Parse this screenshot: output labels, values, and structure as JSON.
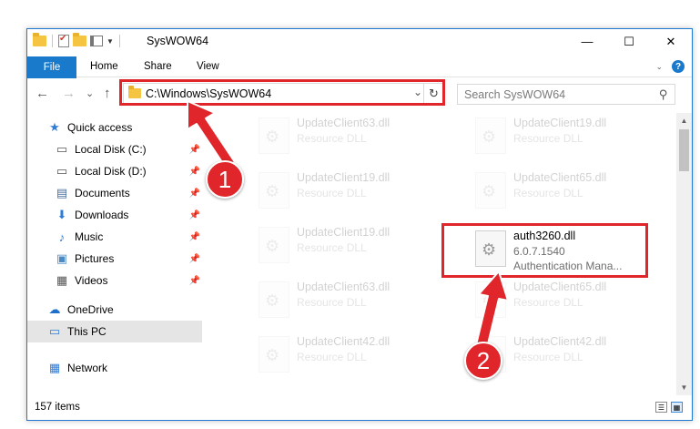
{
  "window": {
    "title": "SysWOW64",
    "minimize": "—",
    "maximize": "☐",
    "close": "✕"
  },
  "ribbon": {
    "tabs": [
      "File",
      "Home",
      "Share",
      "View"
    ]
  },
  "nav": {
    "back": "←",
    "forward": "→",
    "recent": "⌄",
    "up": "↑",
    "address": "C:\\Windows\\SysWOW64",
    "chevron": "⌄",
    "refresh": "↻",
    "search_placeholder": "Search SysWOW64",
    "search_glyph": "⚲"
  },
  "sidebar": {
    "items": [
      {
        "label": "Quick access",
        "icon": "star-icon",
        "glyph": "★",
        "color": "#2f7bd6",
        "pinned": false
      },
      {
        "label": "Local Disk (C:)",
        "icon": "drive-icon",
        "glyph": "▭",
        "color": "#555555",
        "pinned": true
      },
      {
        "label": "Local Disk (D:)",
        "icon": "drive-icon",
        "glyph": "▭",
        "color": "#555555",
        "pinned": true
      },
      {
        "label": "Documents",
        "icon": "document-icon",
        "glyph": "▤",
        "color": "#4d6f9b",
        "pinned": true
      },
      {
        "label": "Downloads",
        "icon": "download-icon",
        "glyph": "⬇",
        "color": "#2f7bd6",
        "pinned": true
      },
      {
        "label": "Music",
        "icon": "music-icon",
        "glyph": "♪",
        "color": "#2f7bd6",
        "pinned": true
      },
      {
        "label": "Pictures",
        "icon": "pictures-icon",
        "glyph": "▣",
        "color": "#4d8ac6",
        "pinned": true
      },
      {
        "label": "Videos",
        "icon": "video-icon",
        "glyph": "▦",
        "color": "#555555",
        "pinned": true
      },
      {
        "label": "OneDrive",
        "icon": "cloud-icon",
        "glyph": "☁",
        "color": "#1e6fc8",
        "pinned": false
      },
      {
        "label": "This PC",
        "icon": "computer-icon",
        "glyph": "▭",
        "color": "#2f7bd6",
        "pinned": false
      },
      {
        "label": "Network",
        "icon": "network-icon",
        "glyph": "▦",
        "color": "#2f7bd6",
        "pinned": false
      }
    ],
    "pin_glyph": "📌"
  },
  "files": [
    {
      "name": "UpdateClient63.dll",
      "type": "Resource DLL",
      "faded": true
    },
    {
      "name": "UpdateClient19.dll",
      "type": "Resource DLL",
      "faded": true
    },
    {
      "name": "UpdateClient19.dll",
      "type": "Resource DLL",
      "faded": true
    },
    {
      "name": "UpdateClient65.dll",
      "type": "Resource DLL",
      "faded": true
    },
    {
      "name": "UpdateClient19.dll",
      "type": "Resource DLL",
      "faded": true
    },
    {
      "name": "auth3260.dll",
      "version": "6.0.7.1540",
      "type": "Authentication Mana...",
      "faded": false
    },
    {
      "name": "UpdateClient63.dll",
      "type": "Resource DLL",
      "faded": true
    },
    {
      "name": "UpdateClient65.dll",
      "type": "Resource DLL",
      "faded": true
    },
    {
      "name": "UpdateClient42.dll",
      "type": "Resource DLL",
      "faded": true
    },
    {
      "name": "UpdateClient42.dll",
      "type": "Resource DLL",
      "faded": true
    }
  ],
  "status": {
    "items_count": "157 items"
  },
  "annotations": {
    "step1": "1",
    "step2": "2",
    "color": "#e0262b"
  }
}
